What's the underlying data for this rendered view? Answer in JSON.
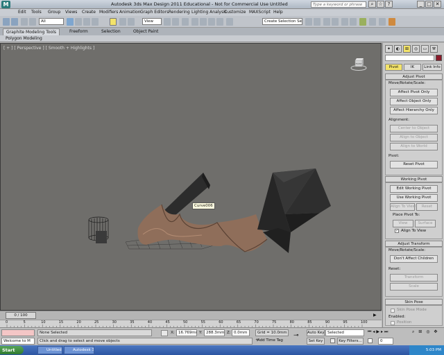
{
  "window": {
    "title": "Autodesk 3ds Max Design 2011   Educational - Not for Commercial Use   Untitled",
    "search_placeholder": "Type a keyword or phrase"
  },
  "menu": [
    "Edit",
    "Tools",
    "Group",
    "Views",
    "Create",
    "Modifiers",
    "Animation",
    "Graph Editors",
    "Rendering",
    "Lighting Analysis",
    "Customize",
    "MAXScript",
    "Help"
  ],
  "toolbar": {
    "selection_filter": "All",
    "ref_coord": "View",
    "named_selection": "Create Selection Se"
  },
  "ribbon": {
    "tabs": [
      "Graphite Modeling Tools",
      "Freeform",
      "Selection",
      "Object Paint"
    ],
    "subtab": "Polygon Modeling"
  },
  "viewport": {
    "label": "[ + ] [ Perspective ] [ Smooth + Highlights ]",
    "tooltip": "Curve006",
    "viewcube_label": "FRONT"
  },
  "command_panel": {
    "tabs": [
      "Pivot",
      "IK",
      "Link Info"
    ],
    "adjust_pivot": {
      "title": "Adjust Pivot",
      "move_label": "Move/Rotate/Scale:",
      "buttons": [
        "Affect Pivot Only",
        "Affect Object Only",
        "Affect Hierarchy Only"
      ],
      "alignment_label": "Alignment:",
      "align_buttons": [
        "Center to Object",
        "Align to Object",
        "Align to World"
      ],
      "pivot_label": "Pivot:",
      "reset_pivot": "Reset Pivot"
    },
    "working_pivot": {
      "title": "Working Pivot",
      "buttons": [
        "Edit Working Pivot",
        "Use Working Pivot"
      ],
      "align_to_view": "Align To View",
      "reset": "Reset",
      "place_label": "Place Pivot To:",
      "view": "View",
      "surface": "Surface",
      "align_checkbox": "Align To View"
    },
    "adjust_transform": {
      "title": "Adjust Transform",
      "move_label": "Move/Rotate/Scale:",
      "dont_affect": "Don't Affect Children",
      "reset_label": "Reset:",
      "transform": "Transform",
      "scale": "Scale"
    },
    "skin_pose": {
      "title": "Skin Pose",
      "mode": "Skin Pose Mode",
      "enabled": "Enabled:",
      "position": "Position"
    }
  },
  "timeline": {
    "current": "0 / 100",
    "ticks": [
      "0",
      "5",
      "10",
      "15",
      "20",
      "25",
      "30",
      "35",
      "40",
      "45",
      "50",
      "55",
      "60",
      "65",
      "70",
      "75",
      "80",
      "85",
      "90",
      "95",
      "100"
    ]
  },
  "status": {
    "welcome": "Welcome to M",
    "selection": "None Selected",
    "prompt": "Click and drag to select and move objects",
    "x_label": "X:",
    "x_value": "16.769mm",
    "y_label": "Y:",
    "y_value": "288.3mm",
    "z_label": "Z:",
    "z_value": "0.0mm",
    "grid": "Grid = 10.0mm",
    "add_time_tag": "Add Time Tag",
    "auto_key": "Auto Key",
    "set_key": "Set Key",
    "selected": "Selected",
    "key_filters": "Key Filters...",
    "frame": "0"
  },
  "taskbar": {
    "start": "Start",
    "tasks": [
      "Untitled",
      "Autodesk 3..."
    ],
    "time": "5:03 PM"
  }
}
